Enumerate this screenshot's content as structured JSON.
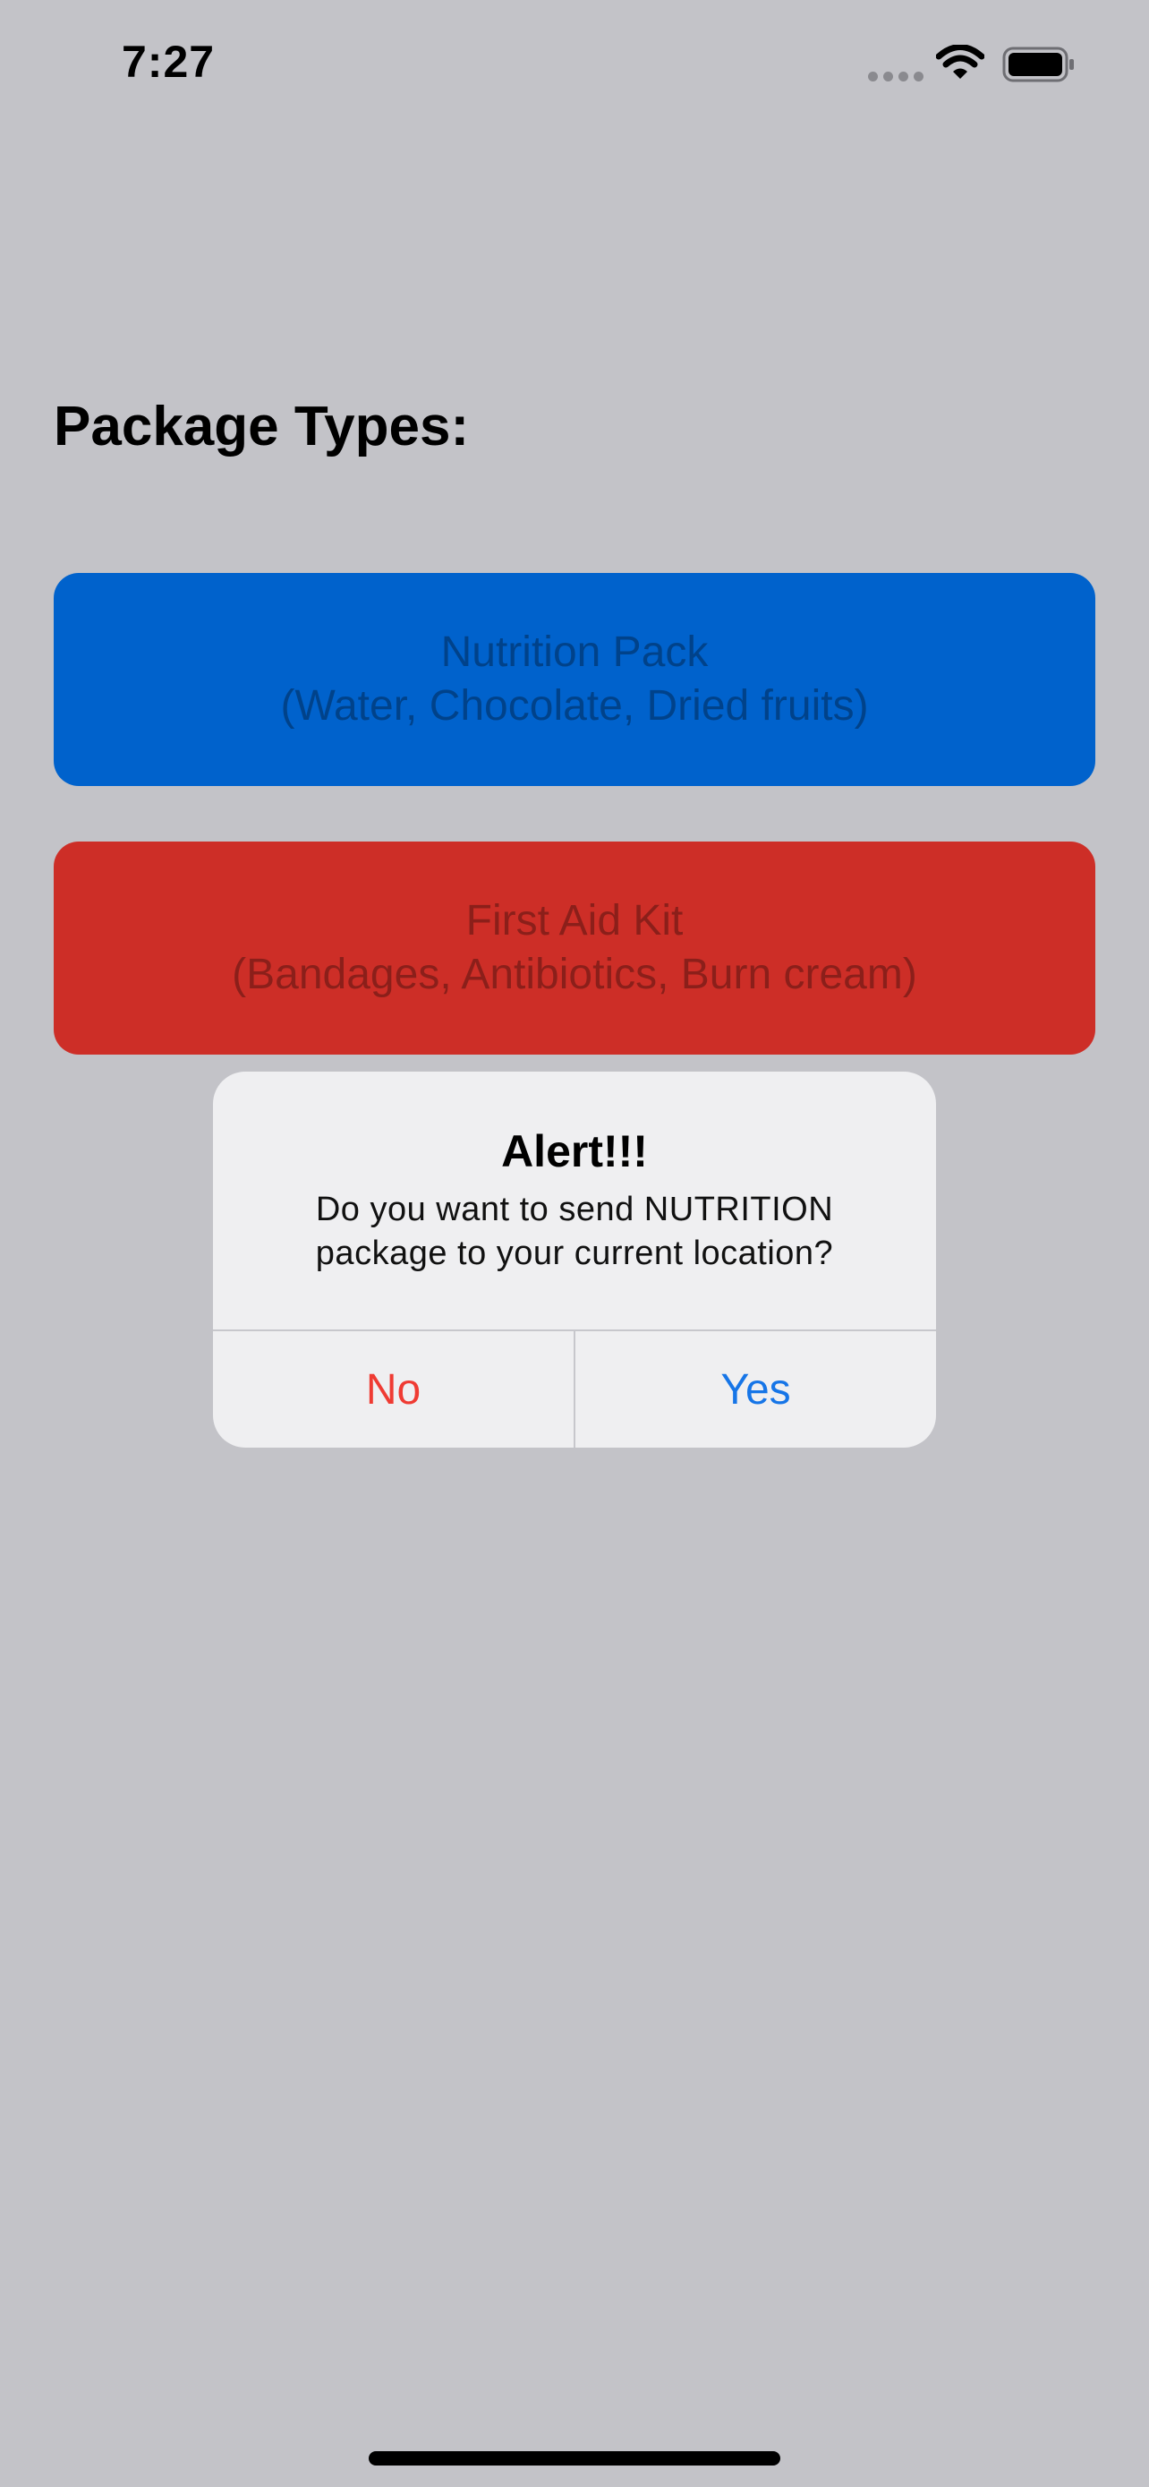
{
  "status_bar": {
    "time": "7:27",
    "icons": [
      "signal-dots-icon",
      "wifi-icon",
      "battery-icon"
    ]
  },
  "main": {
    "title": "Package Types:",
    "packages": [
      {
        "name": "Nutrition Pack",
        "contents": "(Water, Chocolate, Dried fruits)",
        "color": "#0062cc"
      },
      {
        "name": "First Aid Kit",
        "contents": "(Bandages, Antibiotics, Burn cream)",
        "color": "#cd2e27"
      }
    ]
  },
  "alert": {
    "title": "Alert!!!",
    "message_line_1": "Do you want to send NUTRITION",
    "message_line_2": "package to your current location?",
    "actions": [
      {
        "label": "No",
        "color": "#ef3b33"
      },
      {
        "label": "Yes",
        "color": "#1675e7"
      }
    ]
  }
}
